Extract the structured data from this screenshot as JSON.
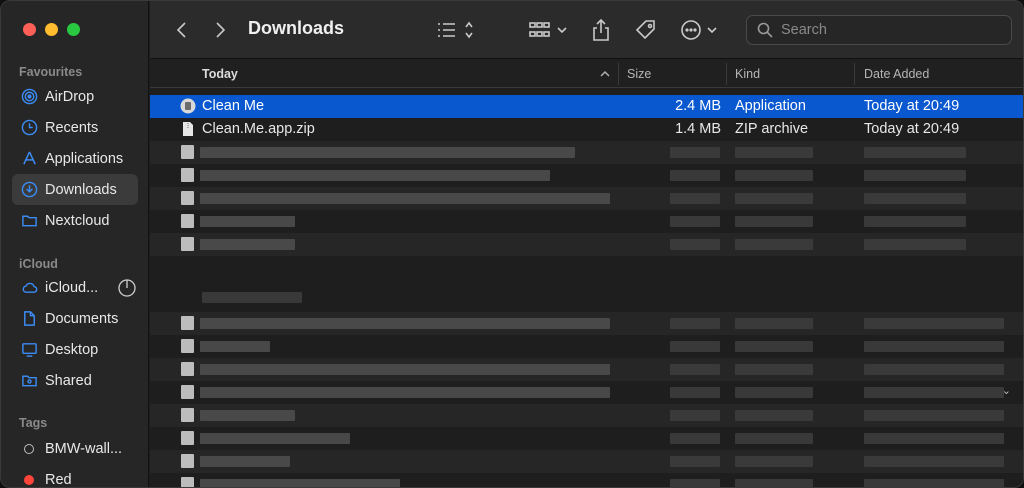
{
  "window": {
    "title": "Downloads"
  },
  "sidebar": {
    "favourites_title": "Favourites",
    "favourites": [
      {
        "label": "AirDrop",
        "icon": "airdrop-icon"
      },
      {
        "label": "Recents",
        "icon": "clock-icon"
      },
      {
        "label": "Applications",
        "icon": "applications-icon"
      },
      {
        "label": "Downloads",
        "icon": "download-icon",
        "active": true
      },
      {
        "label": "Nextcloud",
        "icon": "folder-icon"
      }
    ],
    "icloud_title": "iCloud",
    "icloud": [
      {
        "label": "iCloud...",
        "icon": "cloud-icon"
      },
      {
        "label": "Documents",
        "icon": "document-icon"
      },
      {
        "label": "Desktop",
        "icon": "desktop-icon"
      },
      {
        "label": "Shared",
        "icon": "shared-folder-icon"
      }
    ],
    "tags_title": "Tags",
    "tags": [
      {
        "label": "BMW-wall...",
        "color": "none"
      },
      {
        "label": "Red",
        "color": "#ff453a"
      }
    ]
  },
  "toolbar": {
    "search_placeholder": "Search"
  },
  "columns": {
    "name": "Today",
    "size": "Size",
    "kind": "Kind",
    "date": "Date Added"
  },
  "files": [
    {
      "name": "Clean Me",
      "size": "2.4 MB",
      "kind": "Application",
      "date": "Today at 20:49",
      "selected": true,
      "icon": "app-icon"
    },
    {
      "name": "Clean.Me.app.zip",
      "size": "1.4 MB",
      "kind": "ZIP archive",
      "date": "Today at 20:49",
      "selected": false,
      "icon": "zip-file-icon"
    }
  ],
  "colors": {
    "selection": "#0a58d0",
    "accent": "#0a84ff"
  }
}
